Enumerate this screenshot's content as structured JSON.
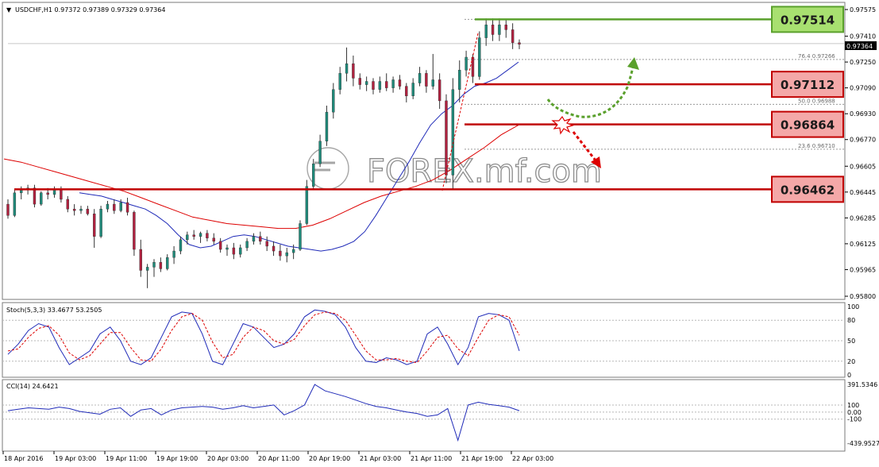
{
  "chart_data": {
    "type": "candlestick",
    "symbol_header": "USDCHF,H1  0.97372 0.97389 0.97329 0.97364",
    "current_price": "0.97364",
    "price_axis_ticks": [
      "0.97575",
      "0.97410",
      "0.97250",
      "0.97090",
      "0.96930",
      "0.96770",
      "0.96605",
      "0.96445",
      "0.96285",
      "0.96125",
      "0.95965",
      "0.95800"
    ],
    "time_axis_ticks": [
      "18 Apr 2016",
      "19 Apr 03:00",
      "19 Apr 11:00",
      "19 Apr 19:00",
      "20 Apr 03:00",
      "20 Apr 11:00",
      "20 Apr 19:00",
      "21 Apr 03:00",
      "21 Apr 11:00",
      "21 Apr 19:00",
      "22 Apr 03:00"
    ],
    "fib_labels": [
      {
        "text": "76.4  0.97266",
        "value": 0.97266
      },
      {
        "text": "50.0  0.96988",
        "value": 0.96988
      },
      {
        "text": "23.6  0.96710",
        "value": 0.9671
      }
    ],
    "levels": [
      {
        "label": "0.97514",
        "value": 0.97514,
        "kind": "resistance",
        "color": "#5aa02c",
        "fill": "#a8e070"
      },
      {
        "label": "0.97112",
        "value": 0.97112,
        "kind": "resistance",
        "color": "#c00000",
        "fill": "#f4a8a8"
      },
      {
        "label": "0.96864",
        "value": 0.96864,
        "kind": "support",
        "color": "#c00000",
        "fill": "#f4a8a8"
      },
      {
        "label": "0.96462",
        "value": 0.96462,
        "kind": "support",
        "color": "#c00000",
        "fill": "#f4a8a8"
      }
    ],
    "watermark": "FOREX.mf.com",
    "ylim": [
      0.958,
      0.97575
    ],
    "candles": [
      [
        0.9637,
        0.964,
        0.9628,
        0.963
      ],
      [
        0.963,
        0.9646,
        0.9629,
        0.9644
      ],
      [
        0.9644,
        0.9648,
        0.964,
        0.9646
      ],
      [
        0.9646,
        0.9649,
        0.9643,
        0.9647
      ],
      [
        0.9647,
        0.9649,
        0.9635,
        0.9637
      ],
      [
        0.9637,
        0.9645,
        0.9636,
        0.9644
      ],
      [
        0.9644,
        0.9647,
        0.964,
        0.9643
      ],
      [
        0.9643,
        0.9648,
        0.9641,
        0.9646
      ],
      [
        0.9646,
        0.9648,
        0.9638,
        0.964
      ],
      [
        0.964,
        0.9642,
        0.9632,
        0.9634
      ],
      [
        0.9634,
        0.9637,
        0.963,
        0.9633
      ],
      [
        0.9633,
        0.9636,
        0.9631,
        0.9634
      ],
      [
        0.9634,
        0.9636,
        0.963,
        0.9631
      ],
      [
        0.9631,
        0.9634,
        0.961,
        0.9617
      ],
      [
        0.9617,
        0.9636,
        0.9616,
        0.9634
      ],
      [
        0.9634,
        0.9639,
        0.9632,
        0.9637
      ],
      [
        0.9637,
        0.964,
        0.9631,
        0.9633
      ],
      [
        0.9633,
        0.964,
        0.9632,
        0.9638
      ],
      [
        0.9638,
        0.9641,
        0.963,
        0.9632
      ],
      [
        0.9632,
        0.9633,
        0.9605,
        0.9609
      ],
      [
        0.9609,
        0.9615,
        0.9592,
        0.9596
      ],
      [
        0.9596,
        0.96,
        0.9585,
        0.9598
      ],
      [
        0.9598,
        0.9603,
        0.9592,
        0.9601
      ],
      [
        0.9601,
        0.9604,
        0.9595,
        0.9597
      ],
      [
        0.9597,
        0.9606,
        0.9596,
        0.9604
      ],
      [
        0.9604,
        0.9611,
        0.96,
        0.9608
      ],
      [
        0.9608,
        0.9617,
        0.9606,
        0.9615
      ],
      [
        0.9615,
        0.962,
        0.9612,
        0.9618
      ],
      [
        0.9618,
        0.9621,
        0.9615,
        0.9617
      ],
      [
        0.9617,
        0.962,
        0.9613,
        0.9619
      ],
      [
        0.9619,
        0.9621,
        0.9614,
        0.9616
      ],
      [
        0.9616,
        0.9619,
        0.9612,
        0.9614
      ],
      [
        0.9614,
        0.9616,
        0.9607,
        0.9609
      ],
      [
        0.9609,
        0.9612,
        0.9605,
        0.961
      ],
      [
        0.961,
        0.9613,
        0.9603,
        0.9606
      ],
      [
        0.9606,
        0.9612,
        0.9604,
        0.961
      ],
      [
        0.961,
        0.9616,
        0.9608,
        0.9614
      ],
      [
        0.9614,
        0.9619,
        0.9612,
        0.9617
      ],
      [
        0.9617,
        0.962,
        0.9612,
        0.9614
      ],
      [
        0.9614,
        0.9617,
        0.9608,
        0.9611
      ],
      [
        0.9611,
        0.9614,
        0.9605,
        0.9608
      ],
      [
        0.9608,
        0.9612,
        0.9602,
        0.9605
      ],
      [
        0.9605,
        0.961,
        0.9601,
        0.9607
      ],
      [
        0.9607,
        0.9612,
        0.9603,
        0.9609
      ],
      [
        0.9609,
        0.9627,
        0.9608,
        0.9625
      ],
      [
        0.9625,
        0.9652,
        0.9624,
        0.9648
      ],
      [
        0.9648,
        0.9665,
        0.9646,
        0.9662
      ],
      [
        0.9662,
        0.968,
        0.966,
        0.9676
      ],
      [
        0.9676,
        0.9698,
        0.9673,
        0.9694
      ],
      [
        0.9694,
        0.9712,
        0.969,
        0.9708
      ],
      [
        0.9708,
        0.9722,
        0.9705,
        0.9718
      ],
      [
        0.9718,
        0.9734,
        0.9713,
        0.9724
      ],
      [
        0.9724,
        0.9729,
        0.971,
        0.9715
      ],
      [
        0.9715,
        0.9718,
        0.9708,
        0.9711
      ],
      [
        0.9711,
        0.9716,
        0.9707,
        0.9713
      ],
      [
        0.9713,
        0.9715,
        0.9705,
        0.9708
      ],
      [
        0.9708,
        0.9716,
        0.9706,
        0.9713
      ],
      [
        0.9713,
        0.9718,
        0.9707,
        0.9709
      ],
      [
        0.9709,
        0.9716,
        0.9706,
        0.9714
      ],
      [
        0.9714,
        0.9717,
        0.9708,
        0.971
      ],
      [
        0.971,
        0.9712,
        0.97,
        0.9704
      ],
      [
        0.9704,
        0.9715,
        0.9702,
        0.9712
      ],
      [
        0.9712,
        0.9722,
        0.971,
        0.9718
      ],
      [
        0.9718,
        0.972,
        0.9706,
        0.971
      ],
      [
        0.971,
        0.973,
        0.9708,
        0.9714
      ],
      [
        0.9714,
        0.9718,
        0.9696,
        0.9701
      ],
      [
        0.9701,
        0.9705,
        0.965,
        0.9655
      ],
      [
        0.9655,
        0.9715,
        0.9646,
        0.9708
      ],
      [
        0.9708,
        0.9726,
        0.97,
        0.972
      ],
      [
        0.972,
        0.9732,
        0.9716,
        0.9728
      ],
      [
        0.9728,
        0.973,
        0.9712,
        0.9716
      ],
      [
        0.9716,
        0.9744,
        0.9714,
        0.974
      ],
      [
        0.974,
        0.9752,
        0.9735,
        0.9748
      ],
      [
        0.9748,
        0.9752,
        0.9738,
        0.9742
      ],
      [
        0.9742,
        0.9752,
        0.9738,
        0.9748
      ],
      [
        0.9748,
        0.9751,
        0.974,
        0.9745
      ],
      [
        0.9745,
        0.9749,
        0.9733,
        0.9737
      ],
      [
        0.9737,
        0.9739,
        0.9733,
        0.9736
      ]
    ],
    "ma_fast": [
      0.9644,
      0.9643,
      0.9642,
      0.964,
      0.9638,
      0.9636,
      0.9634,
      0.963,
      0.9625,
      0.9618,
      0.9612,
      0.961,
      0.9611,
      0.9614,
      0.9617,
      0.9618,
      0.9617,
      0.9615,
      0.9613,
      0.9611,
      0.961,
      0.9609,
      0.9608,
      0.9609,
      0.9611,
      0.9614,
      0.962,
      0.963,
      0.9641,
      0.9652,
      0.9663,
      0.9675,
      0.9686,
      0.9693,
      0.9698,
      0.9705,
      0.971,
      0.9712,
      0.9715,
      0.972,
      0.9725
    ],
    "ma_slow": [
      0.9665,
      0.9663,
      0.966,
      0.9657,
      0.9654,
      0.9651,
      0.9648,
      0.9645,
      0.9641,
      0.9637,
      0.9633,
      0.9629,
      0.9627,
      0.9625,
      0.9624,
      0.9623,
      0.9622,
      0.9622,
      0.9624,
      0.9628,
      0.9633,
      0.9638,
      0.9642,
      0.9645,
      0.9648,
      0.9652,
      0.9658,
      0.9665,
      0.9672,
      0.968,
      0.9686
    ],
    "stoch": {
      "label": "Stoch(5,3,3) 33.4677 53.2505",
      "ticks": [
        "100",
        "80",
        "50",
        "20",
        "0"
      ],
      "main": [
        30,
        45,
        65,
        75,
        70,
        40,
        15,
        25,
        35,
        60,
        70,
        50,
        20,
        15,
        25,
        55,
        85,
        92,
        90,
        60,
        20,
        15,
        45,
        75,
        70,
        55,
        40,
        45,
        60,
        85,
        95,
        93,
        88,
        70,
        40,
        20,
        18,
        25,
        22,
        15,
        20,
        60,
        70,
        45,
        15,
        40,
        85,
        90,
        88,
        80,
        35
      ],
      "signal": [
        35,
        38,
        55,
        68,
        72,
        58,
        32,
        22,
        28,
        45,
        62,
        62,
        40,
        22,
        20,
        38,
        65,
        85,
        90,
        80,
        48,
        25,
        30,
        55,
        70,
        65,
        50,
        45,
        52,
        72,
        88,
        92,
        90,
        80,
        58,
        35,
        22,
        22,
        24,
        20,
        18,
        35,
        55,
        58,
        38,
        28,
        55,
        80,
        88,
        85,
        58
      ]
    },
    "cci": {
      "label": "CCI(14) 24.6421",
      "ticks": [
        "391.5346",
        "100",
        "0.00",
        "-100",
        "-439.9527"
      ],
      "values": [
        20,
        40,
        60,
        50,
        40,
        70,
        50,
        10,
        -10,
        -30,
        40,
        60,
        -60,
        30,
        50,
        -40,
        30,
        60,
        70,
        80,
        70,
        40,
        60,
        90,
        60,
        80,
        100,
        -40,
        20,
        100,
        390,
        300,
        260,
        220,
        170,
        120,
        80,
        60,
        30,
        0,
        -20,
        -60,
        -40,
        50,
        -400,
        100,
        140,
        110,
        90,
        70,
        20
      ],
      "ylim": [
        -439.9527,
        391.5346
      ]
    }
  }
}
